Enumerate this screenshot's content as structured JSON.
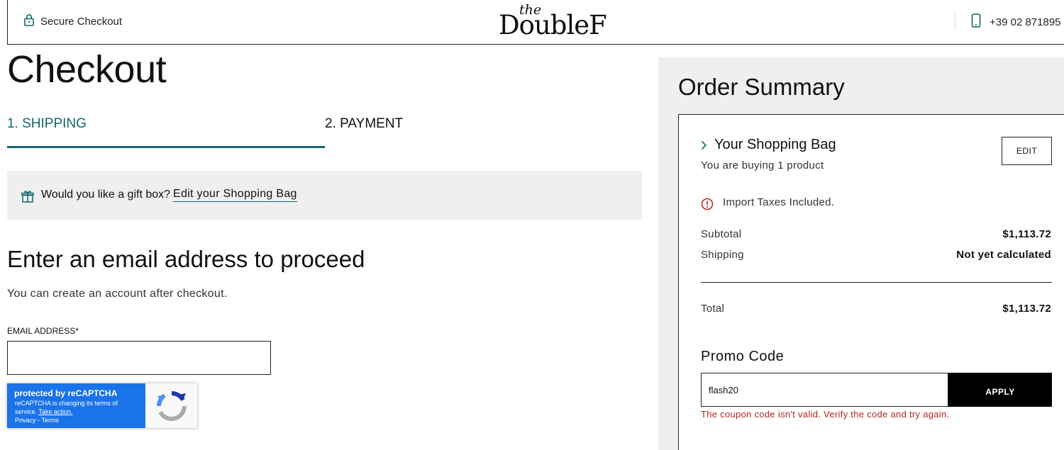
{
  "header": {
    "secure_label": "Secure Checkout",
    "logo_small": "the",
    "logo_main": "DoubleF",
    "phone": "+39 02 871895"
  },
  "checkout": {
    "title": "Checkout",
    "tabs": [
      {
        "label": "1. SHIPPING",
        "active": true
      },
      {
        "label": "2. PAYMENT",
        "active": false
      }
    ],
    "gift": {
      "question": "Would you like a gift box?",
      "link": "Edit your Shopping Bag"
    },
    "email_section": {
      "heading": "Enter an email address to proceed",
      "subtext": "You can create an account after checkout.",
      "label": "EMAIL ADDRESS*",
      "value": ""
    },
    "recaptcha": {
      "title": "protected by reCAPTCHA",
      "line1": "reCAPTCHA is changing its terms of",
      "line2_prefix": "service.",
      "line2_link": "Take action.",
      "links": "Privacy - Terms"
    }
  },
  "summary": {
    "title": "Order Summary",
    "bag_title": "Your Shopping Bag",
    "bag_sub": "You are buying 1 product",
    "edit_label": "EDIT",
    "tax_note": "Import Taxes Included.",
    "subtotal_label": "Subtotal",
    "subtotal_value": "$1,113.72",
    "shipping_label": "Shipping",
    "shipping_value": "Not yet calculated",
    "total_label": "Total",
    "total_value": "$1,113.72",
    "promo_title": "Promo Code",
    "promo_value": "flash20",
    "apply_label": "APPLY",
    "promo_error": "The coupon code isn't valid. Verify the code and try again."
  },
  "colors": {
    "accent": "#13666e",
    "error": "#b3261e",
    "panel_bg": "#efefef",
    "recaptcha_blue": "#1a73e8"
  },
  "icons": [
    "lock-icon",
    "phone-icon",
    "gift-icon",
    "chevron-right-icon",
    "alert-circle-icon",
    "recaptcha-logo-icon"
  ]
}
